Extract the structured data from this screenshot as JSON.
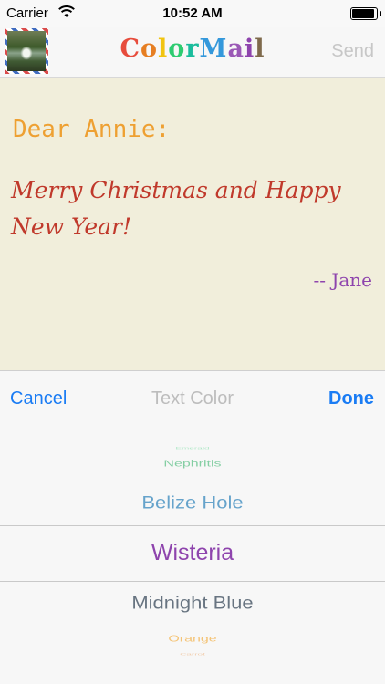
{
  "status_bar": {
    "carrier": "Carrier",
    "time": "10:52 AM",
    "battery_level": 1.0
  },
  "nav_bar": {
    "title_letters": [
      {
        "char": "C",
        "color": "#e74c3c"
      },
      {
        "char": "o",
        "color": "#e67e22"
      },
      {
        "char": "l",
        "color": "#f1c40f"
      },
      {
        "char": "o",
        "color": "#2ecc71"
      },
      {
        "char": "r",
        "color": "#1abc9c"
      },
      {
        "char": "M",
        "color": "#3498db"
      },
      {
        "char": "a",
        "color": "#9b59b6"
      },
      {
        "char": "i",
        "color": "#8e44ad"
      },
      {
        "char": "l",
        "color": "#7f6a4c"
      }
    ],
    "send_label": "Send",
    "stamp_icon": "stamp-photo-icon"
  },
  "letter": {
    "greeting": "Dear Annie:",
    "message_line_1": "Merry Christmas and Happy",
    "message_line_2": "New Year!",
    "signature": "-- Jane",
    "background": "#f1eedb"
  },
  "picker_toolbar": {
    "cancel_label": "Cancel",
    "title": "Text Color",
    "done_label": "Done",
    "accent": "#1a7cf4"
  },
  "picker": {
    "items": [
      {
        "label": "Emerald",
        "color": "#2ecc71"
      },
      {
        "label": "Nephritis",
        "color": "#27ae60"
      },
      {
        "label": "Belize Hole",
        "color": "#2980b9"
      },
      {
        "label": "Wisteria",
        "color": "#8e44ad"
      },
      {
        "label": "Midnight Blue",
        "color": "#2c3e50"
      },
      {
        "label": "Orange",
        "color": "#f39c12"
      },
      {
        "label": "Carrot",
        "color": "#e67e22"
      }
    ],
    "selected": "Wisteria"
  }
}
